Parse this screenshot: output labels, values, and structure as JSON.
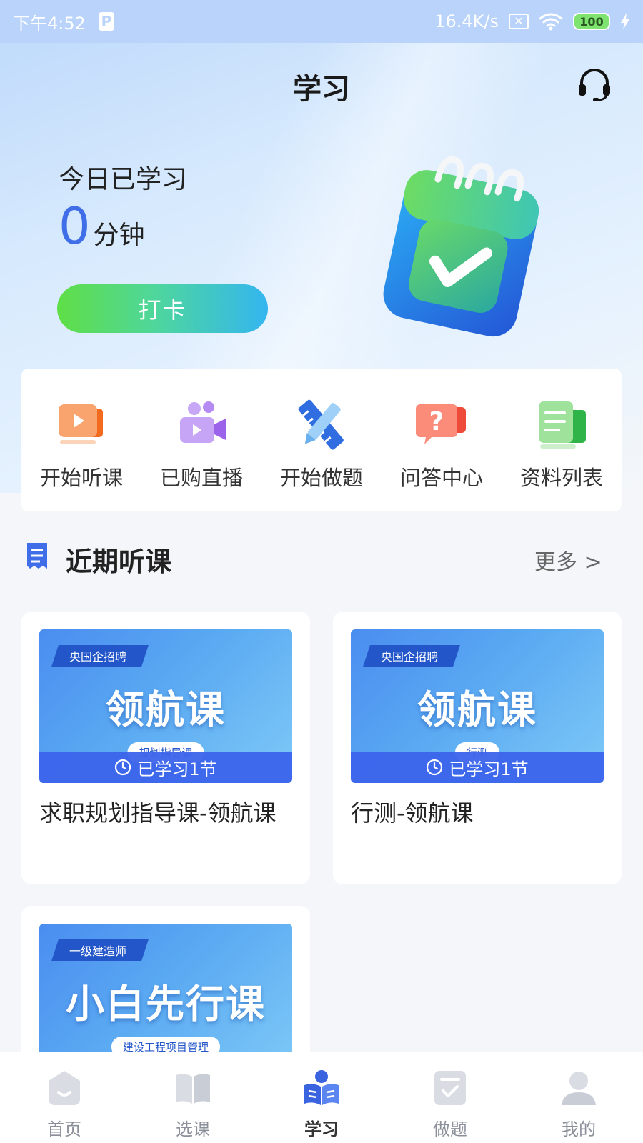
{
  "status_bar": {
    "time": "下午4:52",
    "p_icon": "P",
    "net_speed": "16.4K/s",
    "sim_x": "✕",
    "battery": "100"
  },
  "header": {
    "title": "学习",
    "headset_icon": "headset-icon"
  },
  "today": {
    "label": "今日已学习",
    "minutes": "0",
    "unit": "分钟",
    "checkin_label": "打卡"
  },
  "quick_menu": [
    {
      "label": "开始听课",
      "icon": "video-lesson-icon"
    },
    {
      "label": "已购直播",
      "icon": "live-stream-icon"
    },
    {
      "label": "开始做题",
      "icon": "ruler-pencil-icon"
    },
    {
      "label": "问答中心",
      "icon": "question-bubble-icon"
    },
    {
      "label": "资料列表",
      "icon": "document-list-icon"
    }
  ],
  "recent": {
    "title": "近期听课",
    "more": "更多 >",
    "courses": [
      {
        "tag": "央国企招聘",
        "thumb_title": "领航课",
        "thumb_sub": "规划指导课",
        "progress": "已学习1节",
        "name": "求职规划指导课-领航课"
      },
      {
        "tag": "央国企招聘",
        "thumb_title": "领航课",
        "thumb_sub": "行测",
        "progress": "已学习1节",
        "name": "行测-领航课"
      },
      {
        "tag": "一级建造师",
        "thumb_title": "小白先行课",
        "thumb_sub": "建设工程项目管理",
        "progress": "",
        "name": ""
      }
    ]
  },
  "tab_bar": [
    {
      "label": "首页",
      "icon": "home-icon",
      "active": false
    },
    {
      "label": "选课",
      "icon": "book-icon",
      "active": false
    },
    {
      "label": "学习",
      "icon": "study-reader-icon",
      "active": true
    },
    {
      "label": "做题",
      "icon": "exercise-icon",
      "active": false
    },
    {
      "label": "我的",
      "icon": "profile-icon",
      "active": false
    }
  ],
  "colors": {
    "accent_blue": "#3f6ee8",
    "checkin_gradient_start": "#5fde45",
    "checkin_gradient_end": "#34b6f0",
    "tab_active": "#3a63e0"
  }
}
